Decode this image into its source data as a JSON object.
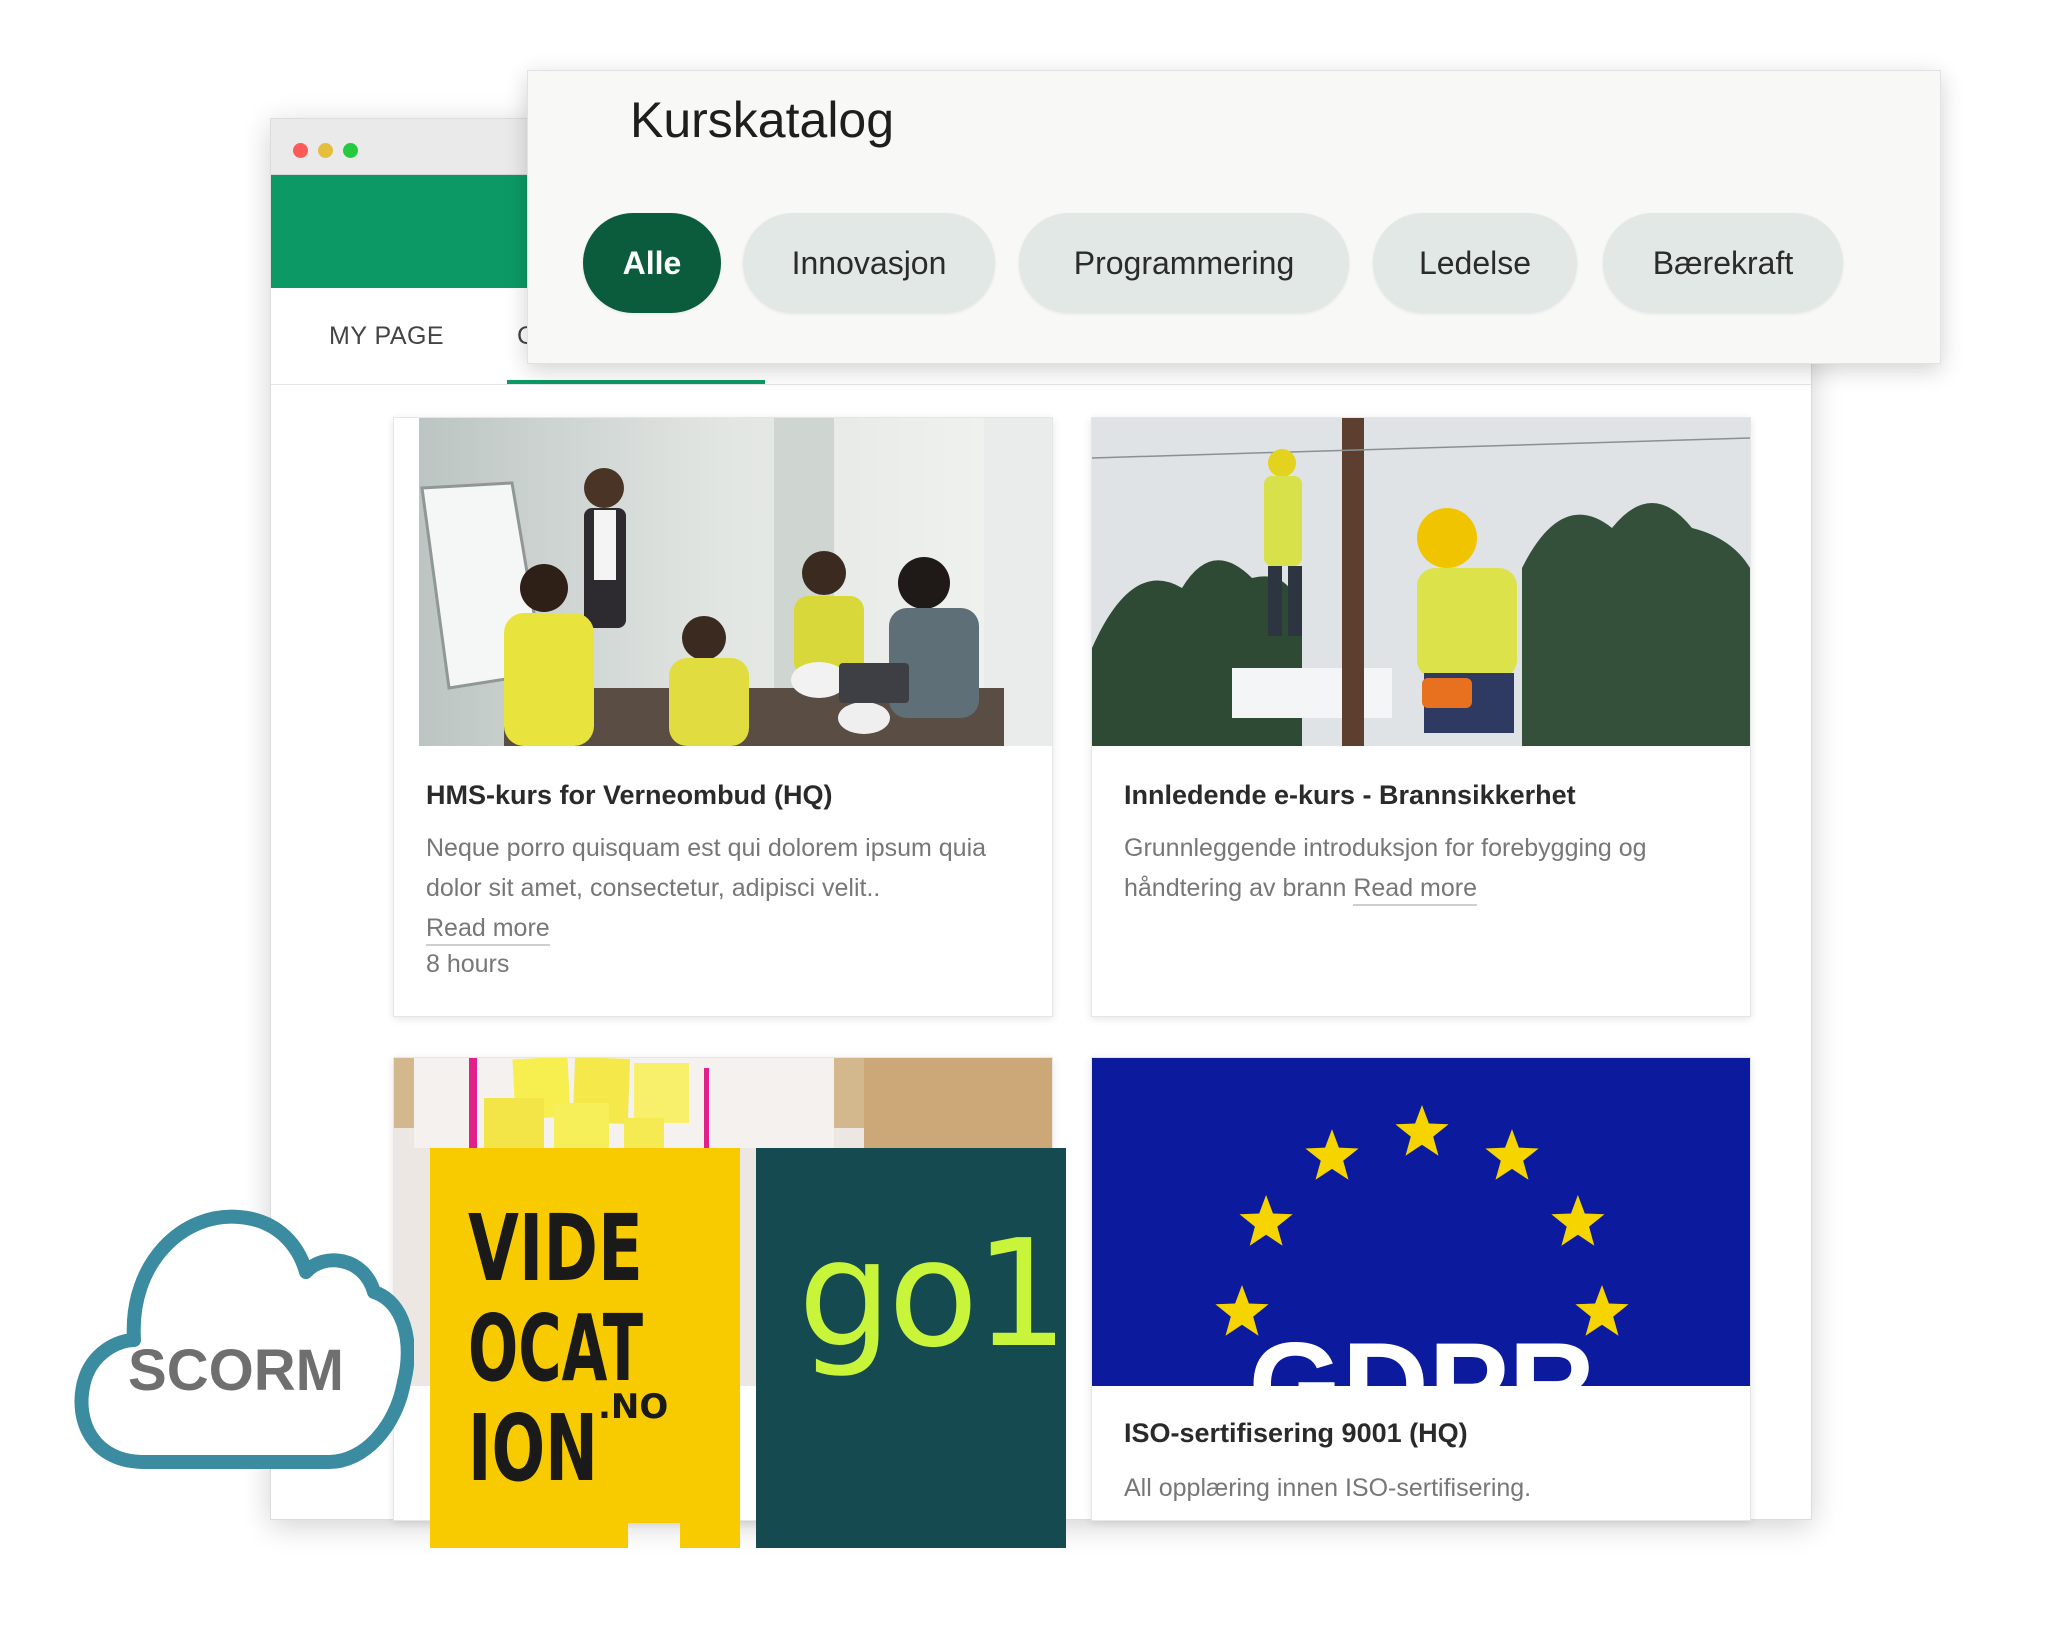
{
  "browser": {
    "nav": {
      "my_page": "MY PAGE",
      "second_tab_partial": "C"
    }
  },
  "catalog": {
    "title": "Kurskatalog",
    "filters": [
      "Alle",
      "Innovasjon",
      "Programmering",
      "Ledelse",
      "Bærekraft"
    ],
    "active_filter": "Alle"
  },
  "courses": [
    {
      "title": "HMS-kurs for Verneombud (HQ)",
      "description": "Neque porro quisquam est qui dolorem ipsum quia dolor sit amet, consectetur, adipisci velit..",
      "read_more": "Read more",
      "duration": "8 hours"
    },
    {
      "title": "Innledende e-kurs - Brannsikkerhet",
      "description": "Grunnleggende introduksjon for forebygging og håndtering av brann",
      "read_more": "Read more"
    },
    {
      "title": "",
      "description": ""
    },
    {
      "title": "ISO-sertifisering 9001 (HQ)",
      "description": "All opplæring innen ISO-sertifisering.",
      "image_text": "GDPR"
    }
  ],
  "logos": {
    "scorm": "SCORM",
    "videocation": [
      "VIDE",
      "OCAT",
      "ION"
    ],
    "videocation_suffix": ".NO",
    "go1": "go1"
  },
  "colors": {
    "brand_green": "#0d9966",
    "chip_active": "#0a5c3c",
    "chip_inactive": "#e2e8e5",
    "videocation_yellow": "#f8cb00",
    "go1_background": "#144a50",
    "go1_text": "#c8f53a",
    "scorm_cloud": "#3b8ba1",
    "eu_blue": "#0c1a9e",
    "eu_star": "#f5d400"
  }
}
